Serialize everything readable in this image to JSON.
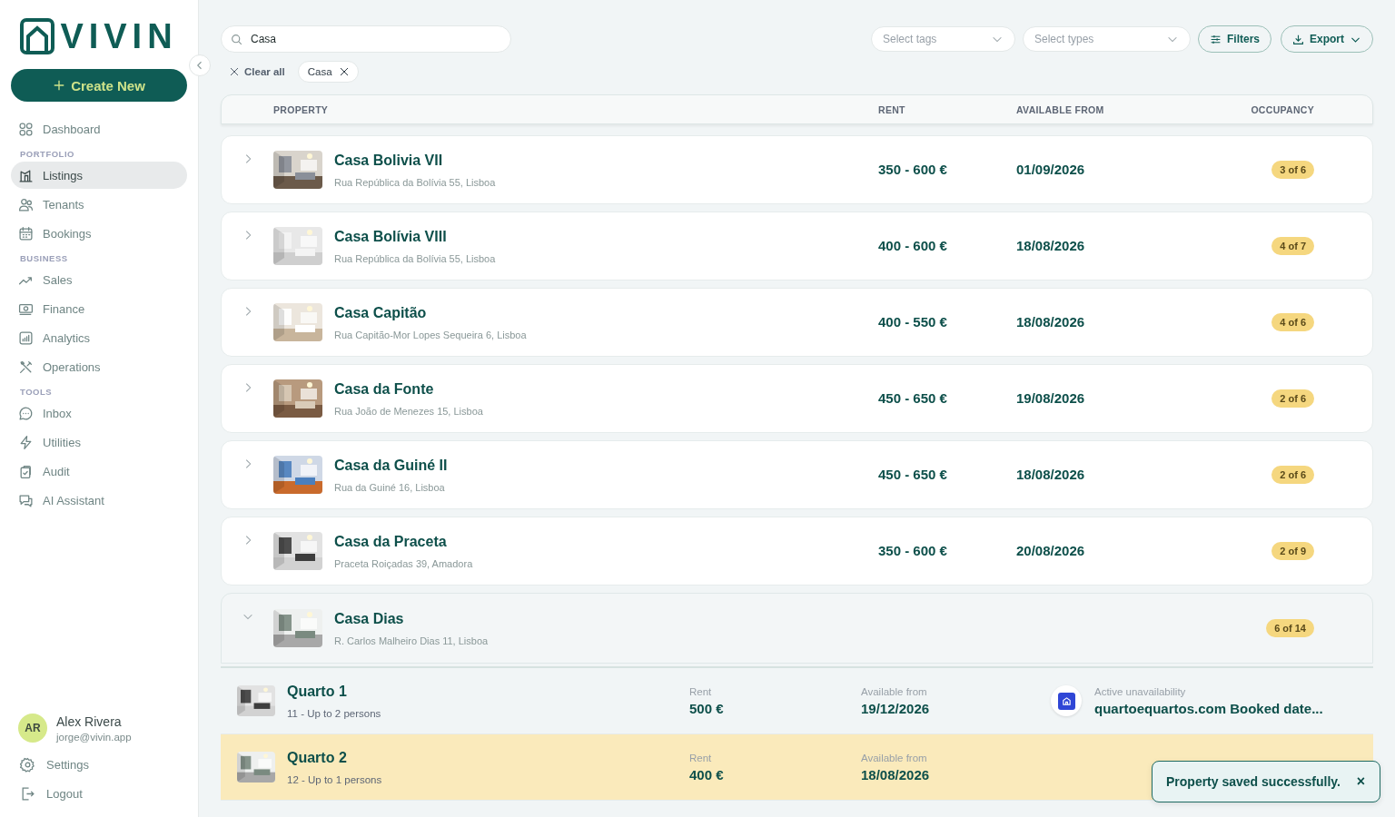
{
  "logo": "VIVIN",
  "create_button": "Create New",
  "sidebar": {
    "groups": [
      {
        "items": [
          {
            "label": "Dashboard",
            "selected": false
          }
        ]
      },
      {
        "label": "PORTFOLIO",
        "items": [
          {
            "label": "Listings",
            "selected": true
          },
          {
            "label": "Tenants",
            "selected": false
          },
          {
            "label": "Bookings",
            "selected": false
          }
        ]
      },
      {
        "label": "BUSINESS",
        "items": [
          {
            "label": "Sales",
            "selected": false
          },
          {
            "label": "Finance",
            "selected": false
          },
          {
            "label": "Analytics",
            "selected": false
          },
          {
            "label": "Operations",
            "selected": false
          }
        ]
      },
      {
        "label": "TOOLS",
        "items": [
          {
            "label": "Inbox",
            "selected": false
          },
          {
            "label": "Utilities",
            "selected": false
          },
          {
            "label": "Audit",
            "selected": false
          },
          {
            "label": "AI Assistant",
            "selected": false
          }
        ]
      }
    ]
  },
  "user": {
    "initials": "AR",
    "name": "Alex Rivera",
    "email": "jorge@vivin.app"
  },
  "footer_links": [
    "Settings",
    "Logout"
  ],
  "search": {
    "value": "Casa"
  },
  "tags_select": {
    "placeholder": "Select tags"
  },
  "types_select": {
    "placeholder": "Select types"
  },
  "filters_button": "Filters",
  "export_button": "Export",
  "clear_all": "Clear all",
  "chips": [
    "Casa"
  ],
  "table": {
    "columns": [
      "PROPERTY",
      "RENT",
      "AVAILABLE FROM",
      "OCCUPANCY"
    ],
    "rows": [
      {
        "name": "Casa Bolivia VII",
        "address": "Rua República da Bolívia 55, Lisboa",
        "rent": "350 - 600 €",
        "available": "01/09/2026",
        "occupancy": "3 of 6",
        "expanded": false
      },
      {
        "name": "Casa Bolívia VIII",
        "address": "Rua República da Bolívia 55, Lisboa",
        "rent": "400 - 600 €",
        "available": "18/08/2026",
        "occupancy": "4 of 7",
        "expanded": false
      },
      {
        "name": "Casa Capitão",
        "address": "Rua Capitão-Mor Lopes Sequeira 6, Lisboa",
        "rent": "400 - 550 €",
        "available": "18/08/2026",
        "occupancy": "4 of 6",
        "expanded": false
      },
      {
        "name": "Casa da Fonte",
        "address": "Rua João de Menezes 15, Lisboa",
        "rent": "450 - 650 €",
        "available": "19/08/2026",
        "occupancy": "2 of 6",
        "expanded": false
      },
      {
        "name": "Casa da Guiné II",
        "address": "Rua da Guiné 16, Lisboa",
        "rent": "450 - 650 €",
        "available": "18/08/2026",
        "occupancy": "2 of 6",
        "expanded": false
      },
      {
        "name": "Casa da Praceta",
        "address": "Praceta Roiçadas 39, Amadora",
        "rent": "350 - 600 €",
        "available": "20/08/2026",
        "occupancy": "2 of 9",
        "expanded": false
      },
      {
        "name": "Casa Dias",
        "address": "R. Carlos Malheiro Dias 11, Lisboa",
        "occupancy": "6 of 14",
        "expanded": true,
        "rooms": [
          {
            "name": "Quarto 1",
            "details": "11 - Up to 2 persons",
            "rent_label": "Rent",
            "rent": "500 €",
            "available_label": "Available from",
            "available": "19/12/2026",
            "highlighted": false,
            "unavailability_label": "Active unavailability",
            "unavailability": "quartoequartos.com Booked date..."
          },
          {
            "name": "Quarto 2",
            "details": "12 - Up to 1 persons",
            "rent_label": "Rent",
            "rent": "400 €",
            "available_label": "Available from",
            "available": "18/08/2026",
            "highlighted": true
          }
        ]
      }
    ]
  },
  "toast": {
    "message": "Property saved successfully.",
    "close": "×"
  }
}
